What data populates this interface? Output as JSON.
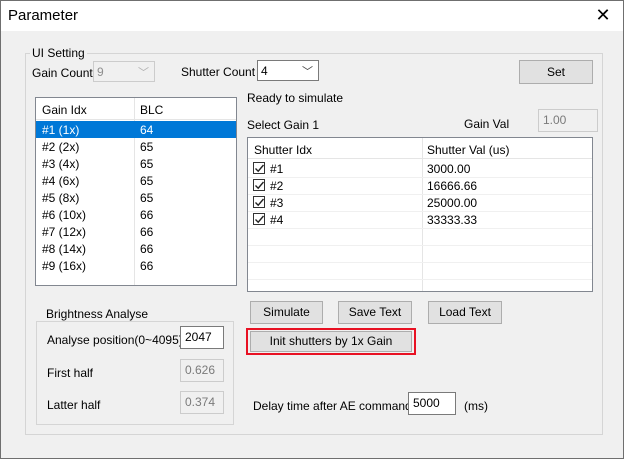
{
  "window": {
    "title": "Parameter"
  },
  "ui_setting": {
    "group_title": "UI Setting",
    "gain_count_label": "Gain Count",
    "gain_count_value": "9",
    "shutter_count_label": "Shutter Count",
    "shutter_count_value": "4",
    "set_label": "Set"
  },
  "status_text": "Ready to simulate",
  "select_gain_text": "Select Gain 1",
  "gain_val": {
    "label": "Gain Val",
    "value": "1.00"
  },
  "gain_table": {
    "headers": [
      "Gain Idx",
      "BLC"
    ],
    "rows": [
      [
        "#1 (1x)",
        "64"
      ],
      [
        "#2 (2x)",
        "65"
      ],
      [
        "#3 (4x)",
        "65"
      ],
      [
        "#4 (6x)",
        "65"
      ],
      [
        "#5 (8x)",
        "65"
      ],
      [
        "#6 (10x)",
        "66"
      ],
      [
        "#7 (12x)",
        "66"
      ],
      [
        "#8 (14x)",
        "66"
      ],
      [
        "#9 (16x)",
        "66"
      ]
    ],
    "selected_index": 0
  },
  "shutter_table": {
    "headers": [
      "Shutter Idx",
      "Shutter Val (us)"
    ],
    "rows": [
      {
        "idx": "#1",
        "val": "3000.00",
        "checked": true
      },
      {
        "idx": "#2",
        "val": "16666.66",
        "checked": true
      },
      {
        "idx": "#3",
        "val": "25000.00",
        "checked": true
      },
      {
        "idx": "#4",
        "val": "33333.33",
        "checked": true
      }
    ]
  },
  "brightness": {
    "group_title": "Brightness Analyse",
    "position_label": "Analyse position(0~4095)",
    "position_value": "2047",
    "first_half_label": "First half",
    "first_half_value": "0.626",
    "latter_half_label": "Latter half",
    "latter_half_value": "0.374"
  },
  "buttons": {
    "simulate": "Simulate",
    "save_text": "Save Text",
    "load_text": "Load Text",
    "init_shutters": "Init shutters by 1x Gain"
  },
  "delay": {
    "label": "Delay time after AE command",
    "value": "5000",
    "unit": "(ms)"
  },
  "colors": {
    "selection": "#0078d7",
    "highlight_border": "#e81123"
  }
}
